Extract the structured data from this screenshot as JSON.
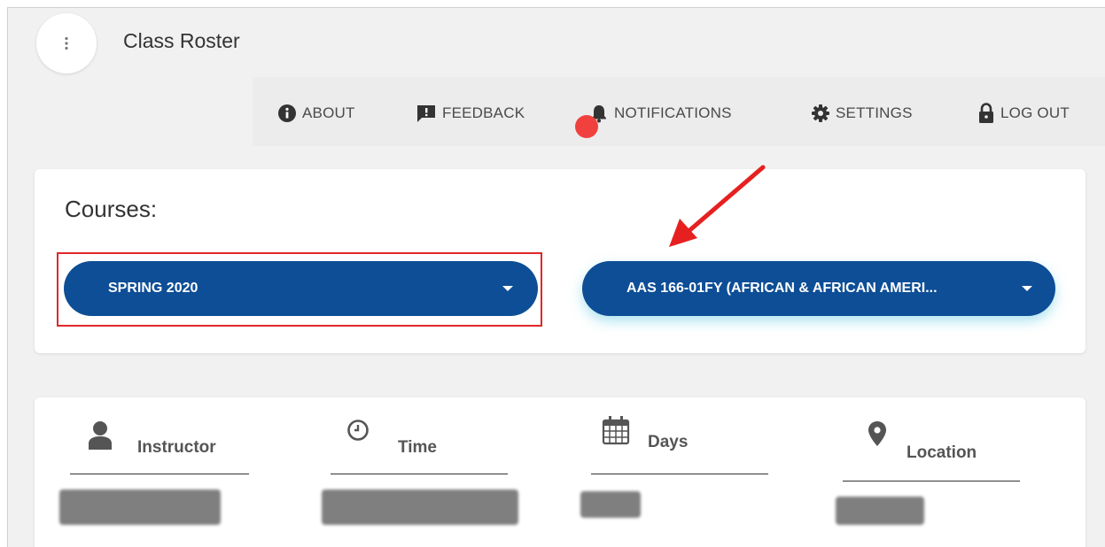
{
  "app": {
    "title": "Class Roster"
  },
  "nav": {
    "about": "ABOUT",
    "feedback": "FEEDBACK",
    "notifications": "NOTIFICATIONS",
    "settings": "SETTINGS",
    "logout": "LOG OUT"
  },
  "courses": {
    "heading": "Courses:",
    "term_selected": "SPRING 2020",
    "course_selected": "AAS 166-01FY (AFRICAN & AFRICAN AMERI..."
  },
  "info": {
    "instructor_label": "Instructor",
    "time_label": "Time",
    "days_label": "Days",
    "location_label": "Location"
  },
  "icons": {
    "menu": "more-vert-icon",
    "about": "info-icon",
    "feedback": "feedback-icon",
    "notifications": "bell-icon",
    "settings": "gear-icon",
    "logout": "lock-icon",
    "instructor": "person-icon",
    "time": "clock-icon",
    "days": "calendar-icon",
    "location": "location-pin-icon"
  },
  "colors": {
    "primary": "#0d4e96",
    "highlight": "#e02828",
    "notification_dot": "#f0413e",
    "background": "#f1f1f1"
  }
}
